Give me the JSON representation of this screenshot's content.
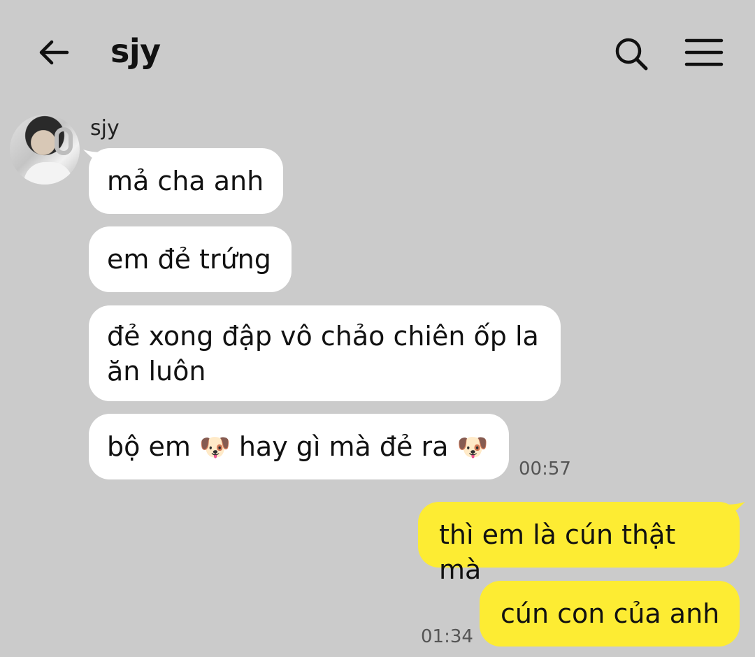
{
  "header": {
    "title": "sjy",
    "icons": {
      "back": "back-arrow-icon",
      "search": "search-icon",
      "menu": "menu-icon"
    }
  },
  "contact": {
    "name": "sjy"
  },
  "messages": [
    {
      "from": "them",
      "text": "mả cha anh"
    },
    {
      "from": "them",
      "text": "em đẻ trứng"
    },
    {
      "from": "them",
      "text": "đẻ xong đập vô chảo chiên ốp la ăn luôn"
    },
    {
      "from": "them",
      "text_before": "bộ em ",
      "text_middle": " hay gì mà đẻ ra ",
      "emoji": "🐶",
      "time": "00:57"
    },
    {
      "from": "me",
      "text": "thì em là cún thật mà"
    },
    {
      "from": "me",
      "text": "cún con của anh",
      "time": "01:34"
    }
  ],
  "colors": {
    "background": "#cbcbcb",
    "incoming_bubble": "#ffffff",
    "outgoing_bubble": "#fdec33"
  }
}
